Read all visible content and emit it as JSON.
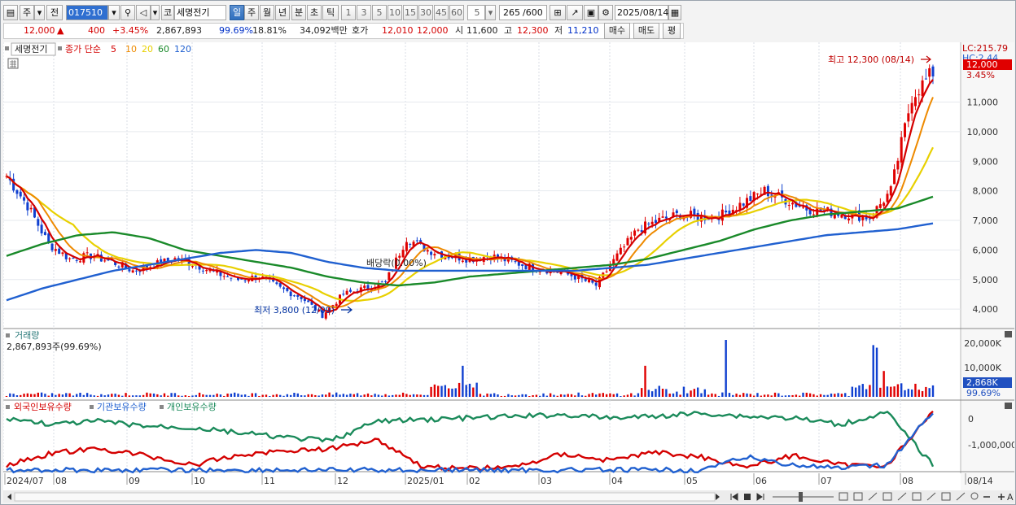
{
  "toolbar": {
    "period_unit": "주",
    "prev_label": "전",
    "stock_code": "017510",
    "market_label": "코",
    "stock_name": "세명전기",
    "period_tabs": [
      "일",
      "주",
      "월",
      "년",
      "분",
      "초",
      "틱"
    ],
    "active_tab": "일",
    "interval_buttons": [
      "1",
      "3",
      "5",
      "10",
      "15",
      "30",
      "45",
      "60"
    ],
    "interval_value": "5",
    "count_value": "265",
    "count_total": "/600",
    "date_value": "2025/08/14"
  },
  "quote": {
    "price": "12,000",
    "change_arrow": "▲",
    "change": "400",
    "change_pct": "+3.45%",
    "volume": "2,867,893",
    "volume_ratio": "99.69%",
    "turnover": "18.81%",
    "amount": "34,092백만",
    "bid_label": "호가",
    "bid": "12,010",
    "ask": "12,000",
    "open_label": "시",
    "open": "11,600",
    "high_label": "고",
    "high": "12,300",
    "low_label": "저",
    "low": "11,210",
    "buy_label": "매수",
    "sell_label": "매도",
    "flat_label": "평"
  },
  "legend": {
    "name": "세명전기",
    "title": "종가 단순",
    "ma": [
      {
        "label": "5",
        "color": "#d40000"
      },
      {
        "label": "10",
        "color": "#ee8a00"
      },
      {
        "label": "20",
        "color": "#e8d000"
      },
      {
        "label": "60",
        "color": "#1a8a2a"
      },
      {
        "label": "120",
        "color": "#2060d0"
      }
    ]
  },
  "annotations": {
    "high_marker": "최고 12,300 (08/14)",
    "low_marker": "최저 3,800 (12/09)",
    "dividend": "배당락(0.00%)",
    "lc_label": "LC:215.79",
    "hc_label": "HC:2.44",
    "price_tag": "12,000",
    "pct_tag": "3.45%"
  },
  "volume_panel": {
    "title": "거래량",
    "info": "2,867,893주(99.69%)",
    "vol_tag": "2,868K",
    "ratio_tag": "99.69%"
  },
  "holding_panel": {
    "series": [
      {
        "name": "외국인보유수량",
        "color": "#d40000"
      },
      {
        "name": "기관보유수량",
        "color": "#2060d0"
      },
      {
        "name": "개인보유수량",
        "color": "#1a8a5a"
      }
    ]
  },
  "chart_data": {
    "type": "line",
    "price_axis": [
      "4,000",
      "5,000",
      "6,000",
      "7,000",
      "8,000",
      "9,000",
      "10,000",
      "11,000"
    ],
    "volume_axis": [
      "10,000K",
      "20,000K"
    ],
    "holding_axis": [
      "0",
      "-1,000,000"
    ],
    "x_labels": [
      "2024/07",
      "08",
      "09",
      "10",
      "11",
      "12",
      "2025/01",
      "02",
      "03",
      "04",
      "05",
      "06",
      "07",
      "08",
      "08/14"
    ],
    "ylim": [
      3400,
      12800
    ],
    "price_points": [
      8500,
      7500,
      6200,
      5700,
      5800,
      5600,
      5300,
      5500,
      5700,
      5500,
      5200,
      5000,
      5100,
      4700,
      4400,
      3800,
      4500,
      4700,
      4900,
      6400,
      6000,
      5800,
      5700,
      5800,
      5600,
      5400,
      5300,
      5100,
      4800,
      5800,
      6700,
      7000,
      7200,
      7100,
      7200,
      7600,
      8000,
      7700,
      7400,
      7300,
      7200,
      7100,
      8000,
      11200,
      12000
    ],
    "ma60_points": [
      5800,
      6200,
      6500,
      6600,
      6400,
      6000,
      5800,
      5600,
      5400,
      5100,
      4900,
      4800,
      4900,
      5100,
      5200,
      5300,
      5400,
      5500,
      5700,
      6000,
      6300,
      6700,
      7000,
      7200,
      7300,
      7400,
      7800
    ],
    "ma120_points": [
      4300,
      4700,
      5000,
      5300,
      5500,
      5700,
      5900,
      6000,
      5900,
      5600,
      5400,
      5300,
      5300,
      5300,
      5300,
      5300,
      5300,
      5400,
      5500,
      5700,
      5900,
      6100,
      6300,
      6500,
      6600,
      6700,
      6900
    ],
    "volume_spikes_K": [
      22000,
      20000,
      19000,
      12000,
      12000,
      10000
    ]
  }
}
